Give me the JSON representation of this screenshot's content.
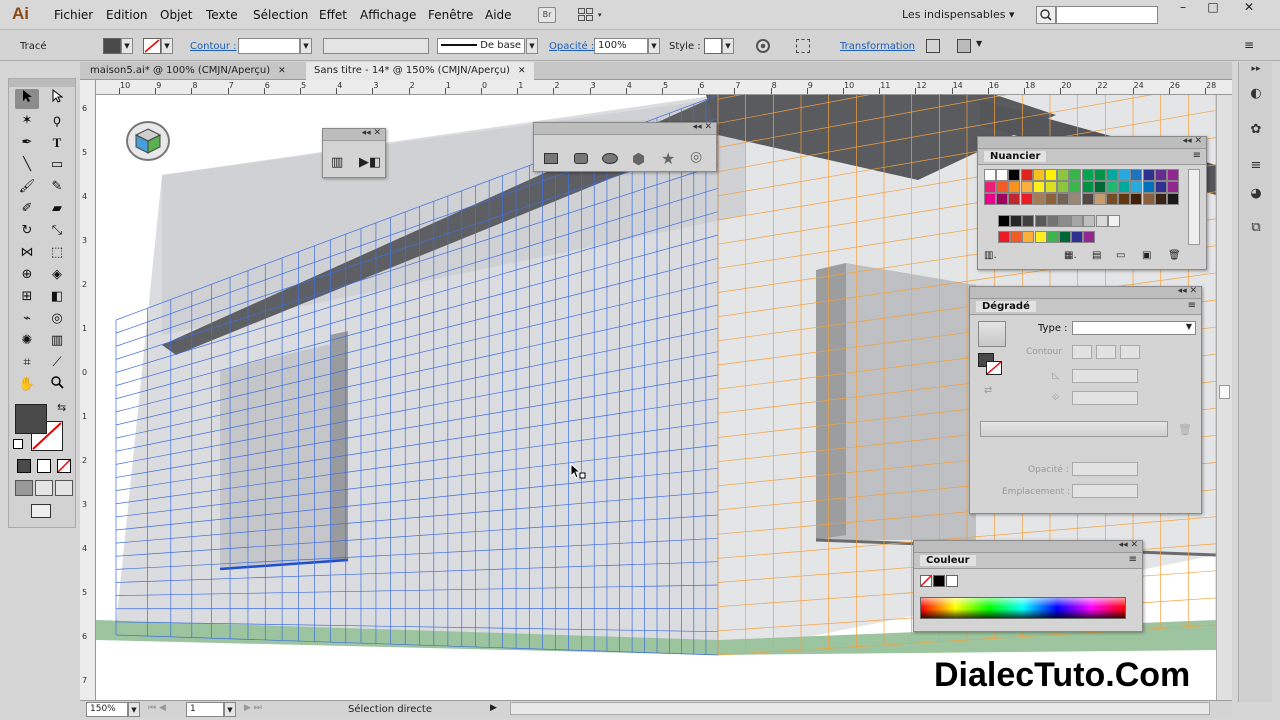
{
  "app": {
    "logo": "Ai",
    "bridge_label": "Br",
    "workspace": "Les indispensables",
    "workspace_arrow": "▾",
    "window_controls": [
      "–",
      "□",
      "✕"
    ]
  },
  "menu": [
    "Fichier",
    "Edition",
    "Objet",
    "Texte",
    "Sélection",
    "Effet",
    "Affichage",
    "Fenêtre",
    "Aide"
  ],
  "control_bar": {
    "selection_type": "Tracé",
    "stroke_label": "Contour :",
    "stroke_profile": "De base",
    "opacity_label": "Opacité :",
    "opacity_value": "100%",
    "style_label": "Style :",
    "transform_label": "Transformation"
  },
  "doc_tabs": [
    {
      "label": "maison5.ai* @ 100% (CMJN/Aperçu)",
      "active": false
    },
    {
      "label": "Sans titre - 14* @ 150% (CMJN/Aperçu)",
      "active": true
    }
  ],
  "tab_close": "✕",
  "ruler_h": [
    "10",
    "9",
    "8",
    "7",
    "6",
    "5",
    "4",
    "3",
    "2",
    "1",
    "0",
    "1",
    "2",
    "3",
    "4",
    "5",
    "6",
    "7",
    "8",
    "9",
    "10",
    "11",
    "12",
    "14",
    "16",
    "18",
    "20",
    "22",
    "24",
    "26",
    "28"
  ],
  "ruler_v": [
    "6",
    "5",
    "4",
    "3",
    "2",
    "1",
    "0",
    "1",
    "2",
    "3",
    "4",
    "5",
    "6",
    "7"
  ],
  "status": {
    "zoom": "150%",
    "artboard": "1",
    "tool_name": "Sélection directe"
  },
  "panels": {
    "nuancier": {
      "title": "Nuancier"
    },
    "degrade": {
      "title": "Dégradé",
      "type_label": "Type :",
      "contour_label": "Contour",
      "opacity_label": "Opacité :",
      "location_label": "Emplacement :"
    },
    "couleur": {
      "title": "Couleur"
    }
  },
  "watermark": "DialecTuto.Com",
  "swatches": [
    [
      "#ffffff",
      "#ffffff",
      "#000000",
      "#e2231a",
      "#f7c11d",
      "#fff200",
      "#8dc63f",
      "#39b54a",
      "#00a651",
      "#009444",
      "#00a99d",
      "#27aae1",
      "#1c75bc",
      "#2e3192",
      "#662d91",
      "#92278f"
    ],
    [
      "#ed1e79",
      "#f15a24",
      "#f7931e",
      "#fbb03b",
      "#fcee21",
      "#d9e021",
      "#8cc63f",
      "#39b54a",
      "#009245",
      "#006837",
      "#22b573",
      "#00a99d",
      "#29abe2",
      "#0071bc",
      "#2e3192",
      "#93278f"
    ],
    [
      "#ec008c",
      "#9e005d",
      "#c1272d",
      "#ed1c24",
      "#a67c52",
      "#8c6239",
      "#736357",
      "#998675",
      "#534741",
      "#c69c6d",
      "#754c24",
      "#603813",
      "#42210b",
      "#8b5e3c",
      "#3c2415",
      "#1a1a1a"
    ]
  ],
  "gray_swatches": [
    "#000000",
    "#262626",
    "#404040",
    "#595959",
    "#737373",
    "#8c8c8c",
    "#a6a6a6",
    "#bfbfbf",
    "#d9d9d9",
    "#f2f2f2"
  ],
  "bright_swatches": [
    "#ed1c24",
    "#f15a24",
    "#fbb03b",
    "#fcee21",
    "#39b54a",
    "#006837",
    "#2e3192",
    "#92278f"
  ]
}
